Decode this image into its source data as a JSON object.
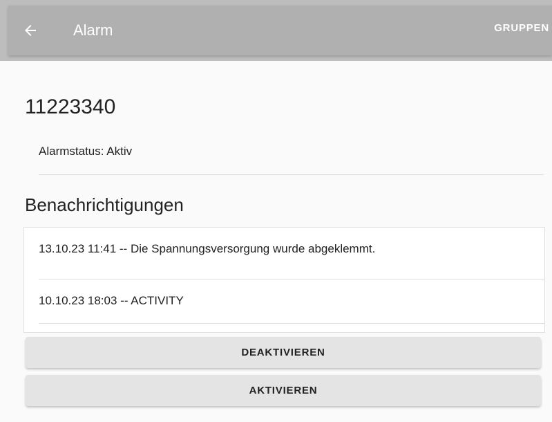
{
  "header": {
    "back_icon": "arrow-left-icon",
    "title": "Alarm",
    "action_label": "GRUPPEN"
  },
  "alarm": {
    "id": "11223340",
    "status_text": "Alarmstatus: Aktiv"
  },
  "notifications": {
    "heading": "Benachrichtigungen",
    "items": [
      {
        "text": "13.10.23 11:41 -- Die Spannungsversorgung wurde abgeklemmt."
      },
      {
        "text": "10.10.23 18:03 -- ACTIVITY"
      }
    ]
  },
  "actions": {
    "deactivate_label": "DEAKTIVIEREN",
    "activate_label": "AKTIVIEREN"
  },
  "colors": {
    "appbar": "#b0b0b0",
    "button_bg": "#e4e4e4",
    "text": "#212121"
  }
}
